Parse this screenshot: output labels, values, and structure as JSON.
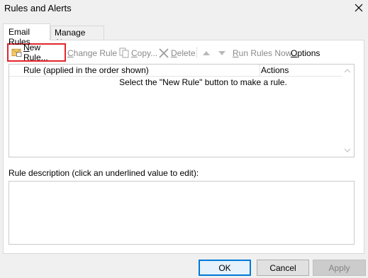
{
  "window": {
    "title": "Rules and Alerts"
  },
  "tabs": [
    {
      "label": "Email Rules",
      "active": true
    },
    {
      "label": "Manage Alerts",
      "active": false
    }
  ],
  "toolbar": {
    "new_rule": {
      "key": "N",
      "rest": "ew Rule..."
    },
    "change_rule": {
      "key": "C",
      "rest": "hange Rule"
    },
    "copy": {
      "key": "C",
      "rest": "opy..."
    },
    "delete": {
      "key": "D",
      "rest": "elete"
    },
    "run_rules": {
      "key": "R",
      "rest": "un Rules Now..."
    },
    "options": {
      "key": "O",
      "rest": "ptions"
    }
  },
  "rules_list": {
    "columns": [
      "Rule (applied in the order shown)",
      "Actions"
    ],
    "empty_message": "Select the \"New Rule\" button to make a rule."
  },
  "description": {
    "label": "Rule description (click an underlined value to edit):"
  },
  "buttons": {
    "ok": "OK",
    "cancel": "Cancel",
    "apply": "Apply"
  },
  "colors": {
    "highlight_border": "#e3262c",
    "ok_border": "#0078d7"
  }
}
